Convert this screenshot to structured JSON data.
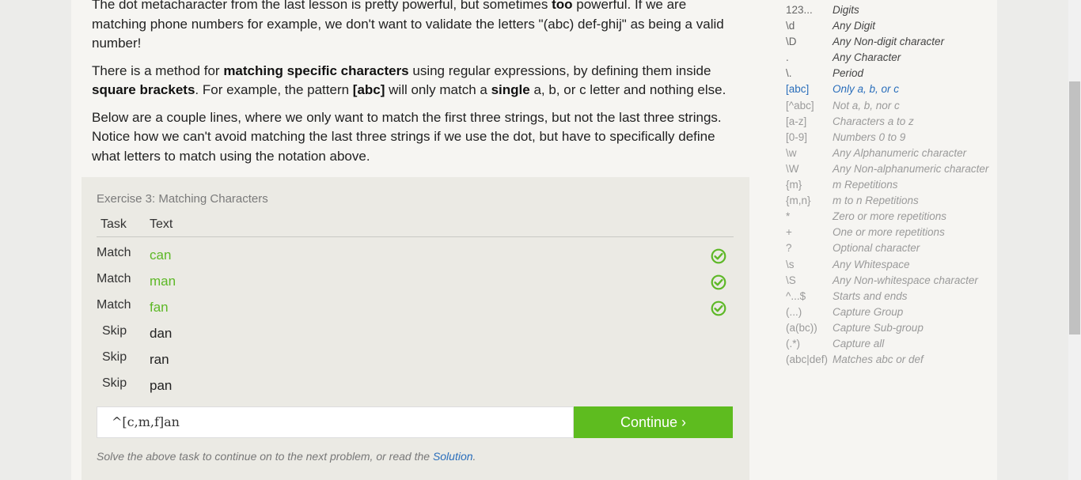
{
  "lesson": {
    "para1": [
      {
        "t": "The dot metacharacter from the last lesson is pretty powerful, but sometimes ",
        "b": false
      },
      {
        "t": "too",
        "b": true
      },
      {
        "t": " powerful. If we are matching phone numbers for example, we don't want to validate the letters \"(abc) def-ghij\" as being a valid number!",
        "b": false
      }
    ],
    "para2": [
      {
        "t": "There is a method for ",
        "b": false
      },
      {
        "t": "matching specific characters",
        "b": true
      },
      {
        "t": " using regular expressions, by defining them inside ",
        "b": false
      },
      {
        "t": "square brackets",
        "b": true
      },
      {
        "t": ". For example, the pattern ",
        "b": false
      },
      {
        "t": "[abc]",
        "b": true
      },
      {
        "t": " will only match a ",
        "b": false
      },
      {
        "t": "single",
        "b": true
      },
      {
        "t": " a, b, or c letter and nothing else.",
        "b": false
      }
    ],
    "para3": [
      {
        "t": "Below are a couple lines, where we only want to match the first three strings, but not the last three strings. Notice how we can't avoid matching the last three strings if we use the dot, but have to specifically define what letters to match using the notation above.",
        "b": false
      }
    ]
  },
  "exercise": {
    "title": "Exercise 3: Matching Characters",
    "col_task": "Task",
    "col_text": "Text",
    "rows": [
      {
        "task": "Match",
        "text": "can",
        "matched": true
      },
      {
        "task": "Match",
        "text": "man",
        "matched": true
      },
      {
        "task": "Match",
        "text": "fan",
        "matched": true
      },
      {
        "task": "Skip",
        "text": "dan",
        "matched": false
      },
      {
        "task": "Skip",
        "text": "ran",
        "matched": false
      },
      {
        "task": "Skip",
        "text": "pan",
        "matched": false
      }
    ],
    "answer_value": "^[c,m,f]an",
    "continue_label": "Continue ›",
    "hint_prefix": "Solve the above task to continue on to the next problem, or read the ",
    "hint_link": "Solution",
    "hint_suffix": "."
  },
  "cheatsheet": [
    {
      "sym": "123...",
      "desc": "Digits",
      "state": "normal"
    },
    {
      "sym": "\\d",
      "desc": "Any Digit",
      "state": "normal"
    },
    {
      "sym": "\\D",
      "desc": "Any Non-digit character",
      "state": "normal"
    },
    {
      "sym": ".",
      "desc": "Any Character",
      "state": "normal"
    },
    {
      "sym": "\\.",
      "desc": "Period",
      "state": "normal"
    },
    {
      "sym": "[abc]",
      "desc": "Only a, b, or c",
      "state": "active"
    },
    {
      "sym": "[^abc]",
      "desc": "Not a, b, nor c",
      "state": "dim"
    },
    {
      "sym": "[a-z]",
      "desc": "Characters a to z",
      "state": "dim"
    },
    {
      "sym": "[0-9]",
      "desc": "Numbers 0 to 9",
      "state": "dim"
    },
    {
      "sym": "\\w",
      "desc": "Any Alphanumeric character",
      "state": "dim"
    },
    {
      "sym": "\\W",
      "desc": "Any Non-alphanumeric character",
      "state": "dim"
    },
    {
      "sym": "{m}",
      "desc": "m Repetitions",
      "state": "dim"
    },
    {
      "sym": "{m,n}",
      "desc": "m to n Repetitions",
      "state": "dim"
    },
    {
      "sym": "*",
      "desc": "Zero or more repetitions",
      "state": "dim"
    },
    {
      "sym": "+",
      "desc": "One or more repetitions",
      "state": "dim"
    },
    {
      "sym": "?",
      "desc": "Optional character",
      "state": "dim"
    },
    {
      "sym": "\\s",
      "desc": "Any Whitespace",
      "state": "dim"
    },
    {
      "sym": "\\S",
      "desc": "Any Non-whitespace character",
      "state": "dim"
    },
    {
      "sym": "^...$",
      "desc": "Starts and ends",
      "state": "dim"
    },
    {
      "sym": "(...)",
      "desc": "Capture Group",
      "state": "dim"
    },
    {
      "sym": "(a(bc))",
      "desc": "Capture Sub-group",
      "state": "dim"
    },
    {
      "sym": "(.*)",
      "desc": "Capture all",
      "state": "dim"
    },
    {
      "sym": "(abc|def)",
      "desc": "Matches abc or def",
      "state": "dim"
    }
  ],
  "colors": {
    "accent_green": "#5ebc1f",
    "matched_text": "#5db826",
    "link_blue": "#2a6ebb"
  },
  "icons": {
    "check": "check-circle-icon"
  }
}
